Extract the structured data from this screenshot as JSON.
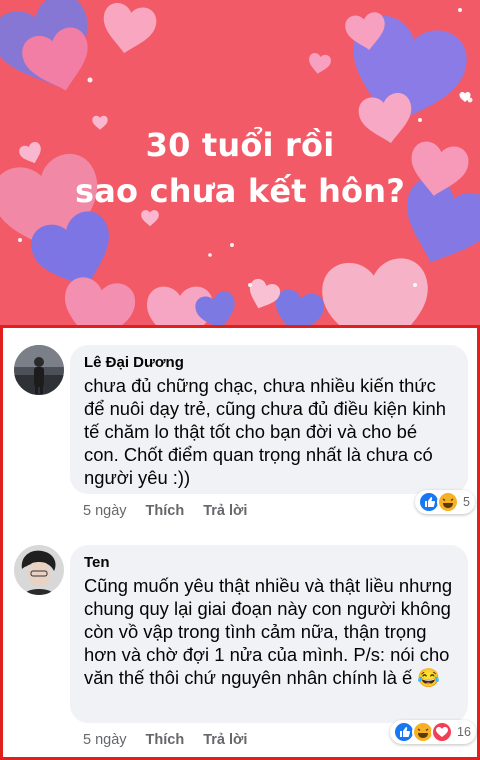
{
  "banner": {
    "title_line1": "30 tuổi rồi",
    "title_line2": "sao chưa kết hôn?",
    "background": "#f35a67"
  },
  "comments": [
    {
      "author": "Lê Đại Dương",
      "text": "chưa đủ chững chạc, chưa nhiều kiến thức để nuôi dạy trẻ, cũng chưa đủ điều kiện kinh tế chăm lo thật tốt cho bạn đời và cho bé con. Chốt điểm quan trọng nhất là chưa có người yêu :))",
      "time": "5 ngày",
      "like_label": "Thích",
      "reply_label": "Trả lời",
      "reactions": [
        "like-icon",
        "haha-icon"
      ],
      "reaction_count": "5"
    },
    {
      "author": "Ten",
      "text": "Cũng muốn yêu thật nhiều và thật liều nhưng chung quy lại giai đoạn này con người không còn vồ vập trong tình cảm nữa, thận trọng hơn và chờ đợi 1 nửa của mình. P/s: nói cho văn thế thôi chứ nguyên nhân chính là ế 😂",
      "time": "5 ngày",
      "like_label": "Thích",
      "reply_label": "Trả lời",
      "reactions": [
        "like-icon",
        "haha-icon",
        "love-icon"
      ],
      "reaction_count": "16"
    }
  ],
  "colors": {
    "frame": "#e0201d",
    "bubble": "#f0f2f5",
    "like": "#1877f2",
    "love": "#f33e58",
    "haha": "#f7b125"
  }
}
